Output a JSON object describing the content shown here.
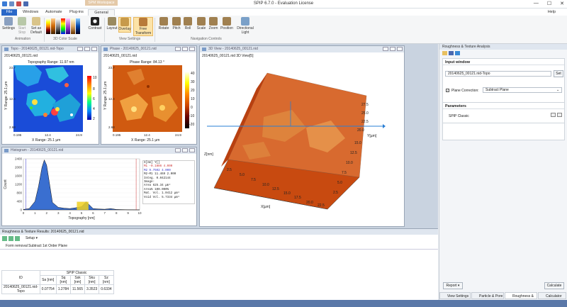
{
  "app": {
    "title": "SPIP 6.7.0 - Evaluation License",
    "context_tab_group": "SPM Workspace",
    "help": "Help",
    "minimize": "—",
    "maximize": "☐",
    "close": "✕"
  },
  "tabs": [
    "File",
    "Windows",
    "Automate",
    "Plug-ins",
    "General"
  ],
  "ribbon": {
    "animation": {
      "label": "Animation",
      "buttons": [
        "Settings",
        "Start Stop",
        "Set as Default"
      ]
    },
    "color_scale": {
      "label": "3D Color Scale"
    },
    "contrast": "Contrast",
    "view_settings": {
      "label": "View Settings",
      "buttons": [
        "Layout",
        "Overlay",
        "Free Transform"
      ]
    },
    "navigation": {
      "label": "Navigation Controls",
      "buttons": [
        "Rotate",
        "Pitch",
        "Roll",
        "Scale",
        "Zoom",
        "Position",
        "Directional Light"
      ]
    }
  },
  "windows": {
    "topo": {
      "title": "Topo - 20140625_00121.nid-Topo",
      "file": "20140625_00121.nid",
      "range": "Topography Range: 11.97 nm",
      "ylabel": "Y Range: 25.1 µm",
      "xlabel": "X Range: 25.1 µm",
      "y_top": "23.7",
      "y_mid": "12.4",
      "y_bot": "2.68",
      "x_left": "0.195",
      "x_mid": "12.4",
      "x_right": "24.9",
      "cb": [
        "10",
        "8",
        "6",
        "4",
        "2"
      ]
    },
    "phase": {
      "title": "Phase - 20140625_00121.nid",
      "file": "20140625_00121.nid",
      "range": "Phase Range: 84.13 °",
      "ylabel": "Y Range: 25.1 µm",
      "xlabel": "X Range: 25.1 µm",
      "y_top": "23.7",
      "y_mid": "12.4",
      "y_bot": "2.68",
      "x_left": "0.195",
      "x_mid": "12.4",
      "x_right": "24.9",
      "cb": [
        "40",
        "30",
        "20",
        "10",
        "0",
        "-10",
        "-20"
      ]
    },
    "view3d": {
      "title": "3D View - 20140625_00121.nid",
      "caption": "20140625_00121.nid 3D View[5]",
      "z_axis": "Z[nm]",
      "x_axis": "X[µm]",
      "y_axis": "Y[µm]",
      "x_ticks": [
        "2.5",
        "5.0",
        "7.5",
        "10.0",
        "12.5",
        "15.0",
        "17.5",
        "20.0",
        "22.5"
      ],
      "y_ticks": [
        "27.5",
        "25.0",
        "22.5",
        "20.0",
        "17.5",
        "15.0",
        "12.5",
        "10.0",
        "7.5",
        "5.0",
        "2.5"
      ]
    },
    "histogram": {
      "title": "Histogram - 20140625_00121.nid",
      "xlabel": "Topography [nm]",
      "ylabel": "Count",
      "stats": [
        [
          "X[nm]",
          "Y[]"
        ],
        [
          "M1",
          "-0.1886 4.000"
        ],
        [
          "M2",
          "9.7502 4.000"
        ],
        [
          "M2-M1",
          "11.469 2.000"
        ],
        [
          "Integ.",
          "0.042144"
        ],
        [
          "Image:",
          ""
        ],
        [
          "Area",
          "625.34 µm²"
        ],
        [
          "Area%",
          "100.000%"
        ],
        [
          "Mat. Vol.",
          "1.0412 µm³"
        ],
        [
          "Void Vol.",
          "5.7334 µm³"
        ]
      ]
    }
  },
  "chart_data": {
    "type": "area",
    "xlabel": "Topography [nm]",
    "ylabel": "Count",
    "x": [
      0,
      0.5,
      1,
      1.3,
      1.6,
      1.8,
      2,
      2.2,
      2.5,
      3,
      3.5,
      4,
      4.5,
      5,
      5.4,
      6,
      6.5,
      7,
      7.5,
      8,
      9,
      10
    ],
    "values": [
      20,
      60,
      400,
      1100,
      2000,
      2350,
      2100,
      1400,
      350,
      120,
      80,
      60,
      100,
      150,
      380,
      60,
      40,
      30,
      60,
      20,
      5,
      0
    ],
    "xlim": [
      0,
      10
    ],
    "ylim": [
      0,
      2400
    ],
    "x_ticks": [
      "0",
      "1",
      "2",
      "3",
      "4",
      "5",
      "6",
      "7",
      "8",
      "9",
      "10"
    ],
    "y_ticks": [
      "0",
      "200",
      "400",
      "600",
      "800",
      "1000",
      "1200",
      "1400",
      "1600",
      "1800",
      "2000",
      "2200",
      "2400"
    ]
  },
  "right_panel": {
    "title": "Roughness & Texture Analysis",
    "input_header": "Input window",
    "input_value": "20140625_00121.nid-Topo",
    "set_button": "Set",
    "plane_label": "Plane Correction:",
    "plane_value": "Subtract Plane",
    "params_header": "Parameters",
    "params_item": "SPIP Classic",
    "report_button": "Report",
    "calc_button": "Calculate"
  },
  "results": {
    "title": "Roughness & Texture Results: 20140625_00121.nid",
    "setup": "Setup",
    "form_removal": "Form removal",
    "form_value": "Subtract 1st Order Plane",
    "group_header": "SPIP Classic",
    "id_header": "ID",
    "columns": [
      "Sa\n[nm]",
      "Sq\n[nm]",
      "Ssk\n[nm]",
      "Sku\n[nm]",
      "Sz\n[nm]"
    ],
    "col_labels": [
      "Sa [nm]",
      "Sq [nm]",
      "Ssk [nm]",
      "Sku [nm]",
      "Sz [nm]"
    ],
    "row_id": "20140625_00121.nid-Topo",
    "row_values": [
      "0.07754",
      "1.2784",
      "11.565",
      "3.3523",
      "0.6334"
    ]
  },
  "bottom_tabs": [
    "View Settings -...",
    "Particle & Pore ...",
    "Roughness & Te...",
    "Calculator"
  ],
  "colors": {
    "accent": "#2a68c8",
    "status": "#5a78a8"
  }
}
